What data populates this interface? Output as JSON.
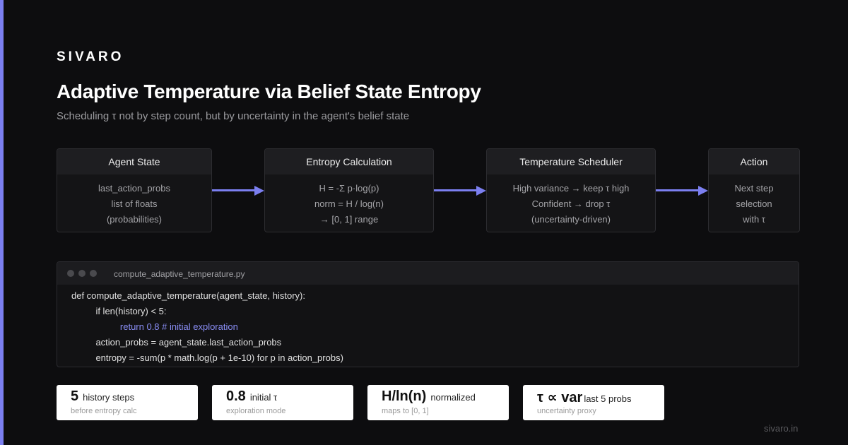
{
  "brand": "SIVARO",
  "title": "Adaptive Temperature via Belief State Entropy",
  "subtitle": "Scheduling τ not by step count, but by uncertainty in the agent's belief state",
  "colors": {
    "accent": "#7b7ff0",
    "background": "#0d0d0f",
    "card": "#ffffff"
  },
  "flow": [
    {
      "title": "Agent State",
      "lines": [
        "last_action_probs",
        "list of floats",
        "(probabilities)"
      ]
    },
    {
      "title": "Entropy Calculation",
      "lines": [
        "H = -Σ p·log(p)",
        "norm = H / log(n)",
        "→ [0, 1] range"
      ]
    },
    {
      "title": "Temperature Scheduler",
      "lines": [
        "High variance → keep τ high",
        "Confident → drop τ",
        "(uncertainty-driven)"
      ]
    },
    {
      "title": "Action",
      "lines": [
        "Next step",
        "selection",
        "with τ"
      ]
    }
  ],
  "code": {
    "filename": "compute_adaptive_temperature.py",
    "lines": [
      "def compute_adaptive_temperature(agent_state, history):",
      "    if len(history) < 5:",
      "        return 0.8 # initial exploration",
      "    action_probs = agent_state.last_action_probs",
      "    entropy = -sum(p * math.log(p + 1e-10) for p in action_probs)"
    ]
  },
  "stats": [
    {
      "value": "5",
      "label": "history steps",
      "sub": "before entropy calc"
    },
    {
      "value": "0.8",
      "label": "initial τ",
      "sub": "exploration mode"
    },
    {
      "value": "H/ln(n)",
      "label": "normalized",
      "sub": "maps to [0, 1]"
    },
    {
      "value": "τ ∝ var",
      "label": "last 5 probs",
      "sub": "uncertainty proxy"
    }
  ],
  "footer": "sivaro.in"
}
